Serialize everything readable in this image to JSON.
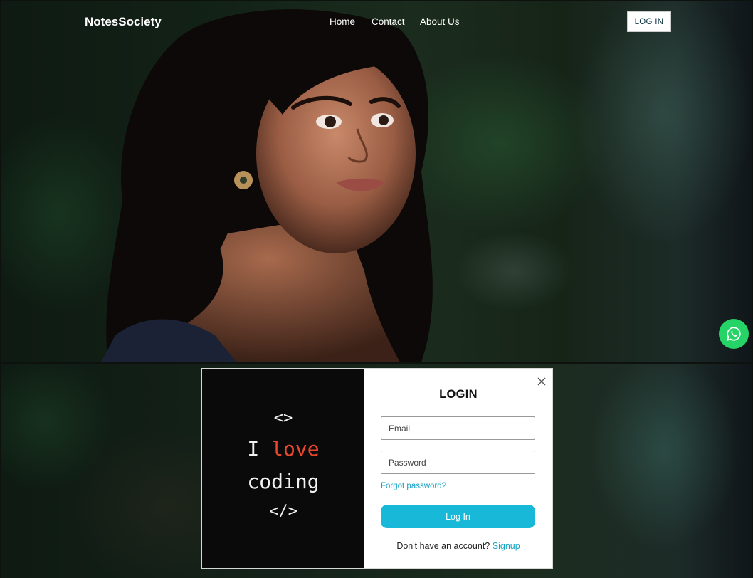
{
  "navbar": {
    "brand": "NotesSociety",
    "links": [
      "Home",
      "Contact",
      "About Us"
    ],
    "login_label": "LOG IN"
  },
  "hero": {
    "image": "portrait-photo"
  },
  "floating": {
    "icon": "whatsapp-icon",
    "color": "#25d366"
  },
  "login_modal": {
    "title": "LOGIN",
    "artwork": {
      "line1": "<>",
      "line2_prefix": "I ",
      "line2_highlight": "love",
      "line3": "coding",
      "line4": "</>"
    },
    "email_placeholder": "Email",
    "password_placeholder": "Password",
    "forgot_label": "Forgot password?",
    "submit_label": "Log In",
    "signup_prompt": "Don't have an account?",
    "signup_label": "Signup",
    "accent_color": "#17b8d8"
  }
}
